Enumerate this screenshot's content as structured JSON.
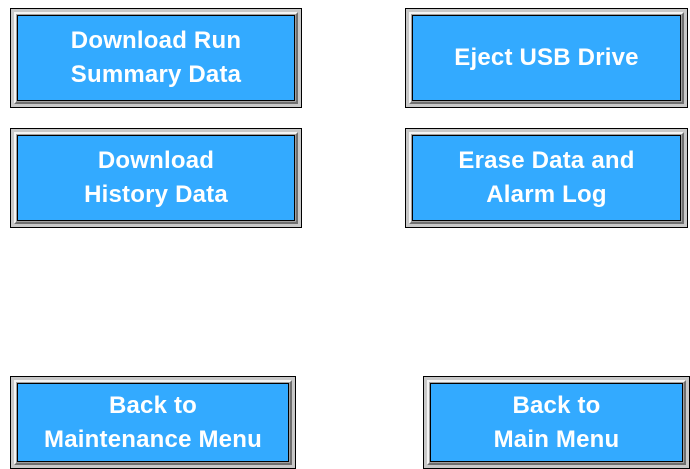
{
  "colors": {
    "button_face": "#33aaff",
    "button_text": "#ffffff",
    "background": "#ffffff"
  },
  "buttons": {
    "download_run_summary": "Download Run\nSummary Data",
    "eject_usb": "Eject USB Drive",
    "download_history": "Download\nHistory Data",
    "erase_data": "Erase Data and\nAlarm Log",
    "back_to_maintenance": "Back to\nMaintenance Menu",
    "back_to_main": "Back to\nMain Menu"
  }
}
